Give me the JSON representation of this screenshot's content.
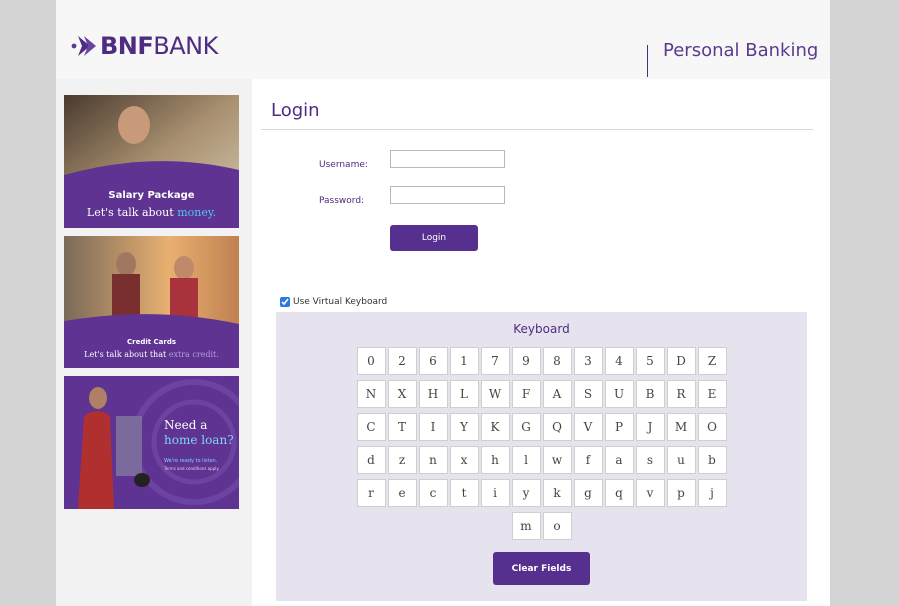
{
  "brand": {
    "logo_bold": "BNF",
    "logo_thin": "BANK",
    "section": "Personal Banking"
  },
  "ads": [
    {
      "line1": "Salary Package",
      "line2_prefix": "Let's talk about ",
      "line2_highlight": "money."
    },
    {
      "line1": "Credit Cards",
      "line2_prefix": "Let's talk about that ",
      "line2_highlight": "extra credit."
    },
    {
      "line1": "Need a",
      "line1_highlight": "home loan?",
      "line2": "We're ready to listen.",
      "line3": "Terms and conditions apply."
    }
  ],
  "login": {
    "title": "Login",
    "username_label": "Username:",
    "username_value": "",
    "password_label": "Password:",
    "password_value": "",
    "button": "Login"
  },
  "keyboard": {
    "toggle_label": "Use Virtual Keyboard",
    "toggle_checked": true,
    "title": "Keyboard",
    "rows": [
      [
        "0",
        "2",
        "6",
        "1",
        "7",
        "9",
        "8",
        "3",
        "4",
        "5",
        "D",
        "Z"
      ],
      [
        "N",
        "X",
        "H",
        "L",
        "W",
        "F",
        "A",
        "S",
        "U",
        "B",
        "R",
        "E"
      ],
      [
        "C",
        "T",
        "I",
        "Y",
        "K",
        "G",
        "Q",
        "V",
        "P",
        "J",
        "M",
        "O"
      ],
      [
        "d",
        "z",
        "n",
        "x",
        "h",
        "l",
        "w",
        "f",
        "a",
        "s",
        "u",
        "b"
      ],
      [
        "r",
        "e",
        "c",
        "t",
        "i",
        "y",
        "k",
        "g",
        "q",
        "v",
        "p",
        "j"
      ],
      [
        "m",
        "o"
      ]
    ],
    "clear_button": "Clear Fields"
  },
  "colors": {
    "brand_purple": "#56308f",
    "text_purple": "#4d2c82",
    "keyboard_bg": "#e6e2ee"
  }
}
